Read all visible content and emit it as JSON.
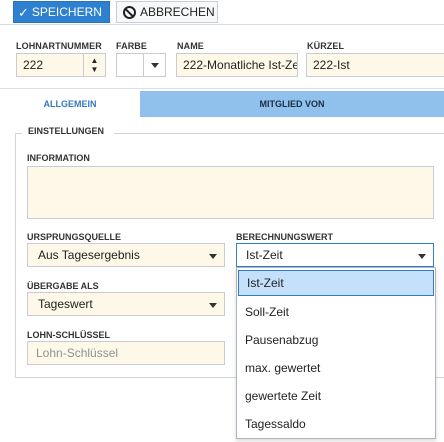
{
  "toolbar": {
    "save_label": "SPEICHERN",
    "cancel_label": "ABBRECHEN"
  },
  "header": {
    "fields": {
      "wage_type_number": {
        "label": "LOHNARTNUMMER",
        "value": "222"
      },
      "color": {
        "label": "FARBE",
        "value": ""
      },
      "name": {
        "label": "NAME",
        "value": "222-Monatliche Ist-Ze"
      },
      "abbreviation": {
        "label": "KÜRZEL",
        "value": "222-Ist"
      }
    }
  },
  "tabs": {
    "general": "ALLGEMEIN",
    "member_of": "MITGLIED VON"
  },
  "settings": {
    "legend": "EINSTELLUNGEN",
    "information": {
      "label": "INFORMATION",
      "value": ""
    },
    "origin_source": {
      "label": "URSPRUNGSQUELLE",
      "value": "Aus Tagesergebnis"
    },
    "calc_value": {
      "label": "BERECHNUNGSWERT",
      "value": "Ist-Zeit"
    },
    "transfer_as": {
      "label": "ÜBERGABE ALS",
      "value": "Tageswert"
    },
    "wage_key": {
      "label": "LOHN-SCHLÜSSEL",
      "placeholder": "Lohn-Schlüssel"
    }
  },
  "dropdown": {
    "options": [
      "Ist-Zeit",
      "Soll-Zeit",
      "Pausenabzug",
      "max. gewertet",
      "gewertete Zeit",
      "Tagessaldo"
    ],
    "selected_index": 0
  },
  "colors": {
    "accent": "#2e81d1",
    "tab_active_bg": "#8fc1ec",
    "field_bg": "#fdf8e7"
  }
}
